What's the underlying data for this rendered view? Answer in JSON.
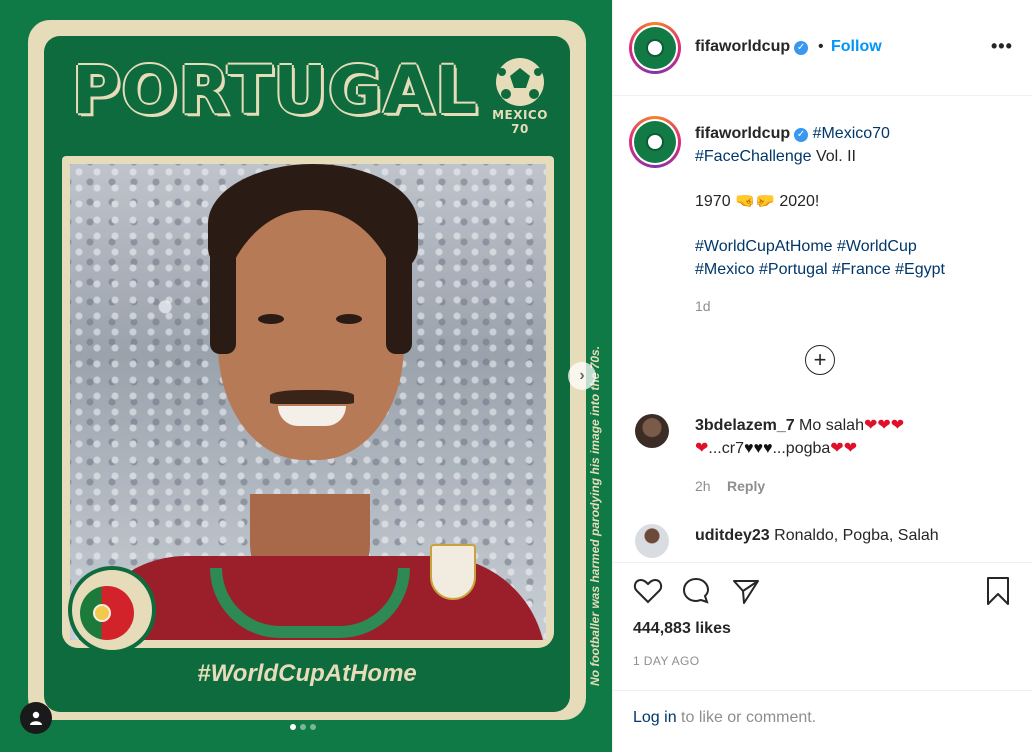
{
  "media": {
    "country": "PORTUGAL",
    "emblem_text": "MEXICO 70",
    "hashtag": "#WorldCupAtHome",
    "vertical_note": "No footballer was harmed parodying his image into the 70s.",
    "carousel_total": 3,
    "carousel_active": 1
  },
  "header": {
    "username": "fifaworldcup",
    "bullet": "•",
    "follow_label": "Follow",
    "more_label": "•••"
  },
  "caption": {
    "username": "fifaworldcup",
    "tag_mexico70": "#Mexico70",
    "tag_facechallenge": "#FaceChallenge",
    "vol": " Vol. II",
    "line_years_a": "1970 ",
    "fists": "🤜🤛",
    "line_years_b": " 2020!",
    "tags": [
      "#WorldCupAtHome",
      "#WorldCup",
      "#Mexico",
      "#Portugal",
      "#France",
      "#Egypt"
    ],
    "time": "1d"
  },
  "load_more_label": "+",
  "comments": [
    {
      "username": "3bdelazem_7",
      "text_a": " Mo salah",
      "hearts_a": "❤❤❤",
      "hearts_b": "❤",
      "text_b": "...cr7",
      "black_hearts": "♥♥♥",
      "text_c": "...pogba",
      "hearts_c": "❤❤",
      "time": "2h",
      "reply": "Reply"
    },
    {
      "username": "uditdey23",
      "text": " Ronaldo, Pogba, Salah"
    }
  ],
  "actions": {
    "likes": "444,883 likes",
    "ago": "1 DAY AGO"
  },
  "footer": {
    "login_link": "Log in",
    "login_rest": " to like or comment."
  },
  "colors": {
    "media_green": "#0f7a46",
    "card_cream": "#e6dcb9",
    "link_blue": "#00376b",
    "follow_blue": "#0095f6"
  }
}
